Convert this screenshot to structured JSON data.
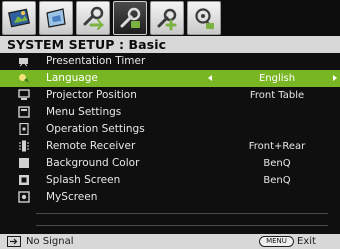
{
  "tabs": [
    {
      "icon": "picture-icon",
      "active": false
    },
    {
      "icon": "display-icon",
      "active": false
    },
    {
      "icon": "system-setup-basic-icon",
      "active": false
    },
    {
      "icon": "system-setup-basic-active-icon",
      "active": true
    },
    {
      "icon": "system-setup-advanced-icon",
      "active": false
    },
    {
      "icon": "information-icon",
      "active": false
    }
  ],
  "title": "SYSTEM SETUP : Basic",
  "menu": {
    "items": [
      {
        "label": "Presentation Timer",
        "value": "",
        "icon": "timer-icon"
      },
      {
        "label": "Language",
        "value": "English",
        "icon": "language-icon",
        "selected": true
      },
      {
        "label": "Projector Position",
        "value": "Front Table",
        "icon": "projector-position-icon"
      },
      {
        "label": "Menu Settings",
        "value": "",
        "icon": "menu-settings-icon"
      },
      {
        "label": "Operation Settings",
        "value": "",
        "icon": "operation-settings-icon"
      },
      {
        "label": "Remote Receiver",
        "value": "Front+Rear",
        "icon": "remote-receiver-icon"
      },
      {
        "label": "Background Color",
        "value": "BenQ",
        "icon": "background-color-icon"
      },
      {
        "label": "Splash Screen",
        "value": "BenQ",
        "icon": "splash-screen-icon"
      },
      {
        "label": "MyScreen",
        "value": "",
        "icon": "myscreen-icon"
      }
    ]
  },
  "footer": {
    "status": "No Signal",
    "menu_key": "MENU",
    "exit": "Exit"
  },
  "colors": {
    "highlight": "#79b623",
    "background": "#0f0f0f",
    "title_bar": "#d8d8d8"
  }
}
